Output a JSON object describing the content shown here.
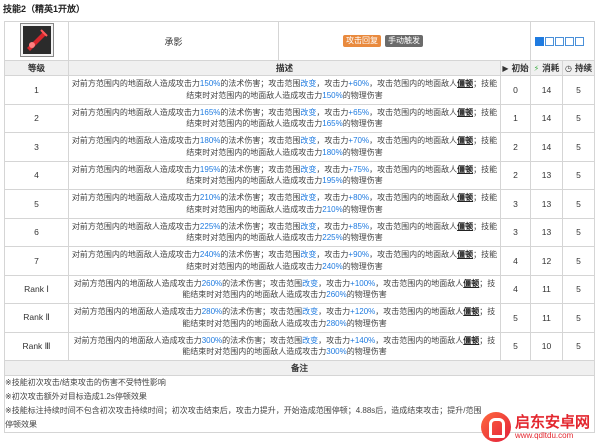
{
  "header": {
    "title": "技能2（精英1开放）",
    "skill_name": "承影",
    "tags": [
      "攻击回复",
      "手动触发"
    ],
    "sp_filled": 1,
    "sp_total": 5
  },
  "columns": {
    "level": "等级",
    "desc": "描述",
    "initial": "初始",
    "cost": "消耗",
    "duration": "持续",
    "initial_icon": "play-icon",
    "cost_icon": "bolt-icon",
    "duration_icon": "clock-icon"
  },
  "rows": [
    {
      "level": "1",
      "atk": "150%",
      "atk_up": "+60%",
      "atk_range": "150%",
      "init": "0",
      "cost": "14",
      "dur": "5"
    },
    {
      "level": "2",
      "atk": "165%",
      "atk_up": "+65%",
      "atk_range": "165%",
      "init": "1",
      "cost": "14",
      "dur": "5"
    },
    {
      "level": "3",
      "atk": "180%",
      "atk_up": "+70%",
      "atk_range": "180%",
      "init": "2",
      "cost": "14",
      "dur": "5"
    },
    {
      "level": "4",
      "atk": "195%",
      "atk_up": "+75%",
      "atk_range": "195%",
      "init": "2",
      "cost": "13",
      "dur": "5"
    },
    {
      "level": "5",
      "atk": "210%",
      "atk_up": "+80%",
      "atk_range": "210%",
      "init": "3",
      "cost": "13",
      "dur": "5"
    },
    {
      "level": "6",
      "atk": "225%",
      "atk_up": "+85%",
      "atk_range": "225%",
      "init": "3",
      "cost": "13",
      "dur": "5"
    },
    {
      "level": "7",
      "atk": "240%",
      "atk_up": "+90%",
      "atk_range": "240%",
      "init": "4",
      "cost": "12",
      "dur": "5"
    },
    {
      "level": "Rank Ⅰ",
      "atk": "260%",
      "atk_up": "+100%",
      "atk_range": "260%",
      "init": "4",
      "cost": "11",
      "dur": "5"
    },
    {
      "level": "Rank Ⅱ",
      "atk": "280%",
      "atk_up": "+120%",
      "atk_range": "280%",
      "init": "5",
      "cost": "11",
      "dur": "5"
    },
    {
      "level": "Rank Ⅲ",
      "atk": "300%",
      "atk_up": "+140%",
      "atk_range": "300%",
      "init": "5",
      "cost": "10",
      "dur": "5"
    }
  ],
  "desc_text": {
    "p1": "对前方范围内的地面敌人造成攻击力",
    "p2": "的法术伤害；攻击范围",
    "p3": "改变",
    "p4": "，攻击力",
    "p5": "，攻击范围内的地面敌人",
    "p6": "僵顿",
    "p7": "；技能结束时对范围内的地面敌人造成攻击力",
    "p8": "的物理伤害"
  },
  "notes": {
    "head": "备注",
    "lines": [
      "※技能初次攻击/结束攻击的伤害不受特性影响",
      "※初次攻击额外对目标造成1.2s停顿效果",
      "※技能标注持续时间不包含初次攻击持续时间；初次攻击结束后，攻击力提升，开始造成范围停顿；4.88s后，造成结束攻击；提升/范围停顿效果"
    ]
  },
  "watermark": {
    "main": "启东安卓网",
    "sub": "www.qdltdu.com"
  },
  "colors": {
    "highlight": "#1f7be0",
    "tag_orange": "#e98a3e",
    "tag_gray": "#6b6b6b",
    "header_bg": "#f0f0f0"
  }
}
